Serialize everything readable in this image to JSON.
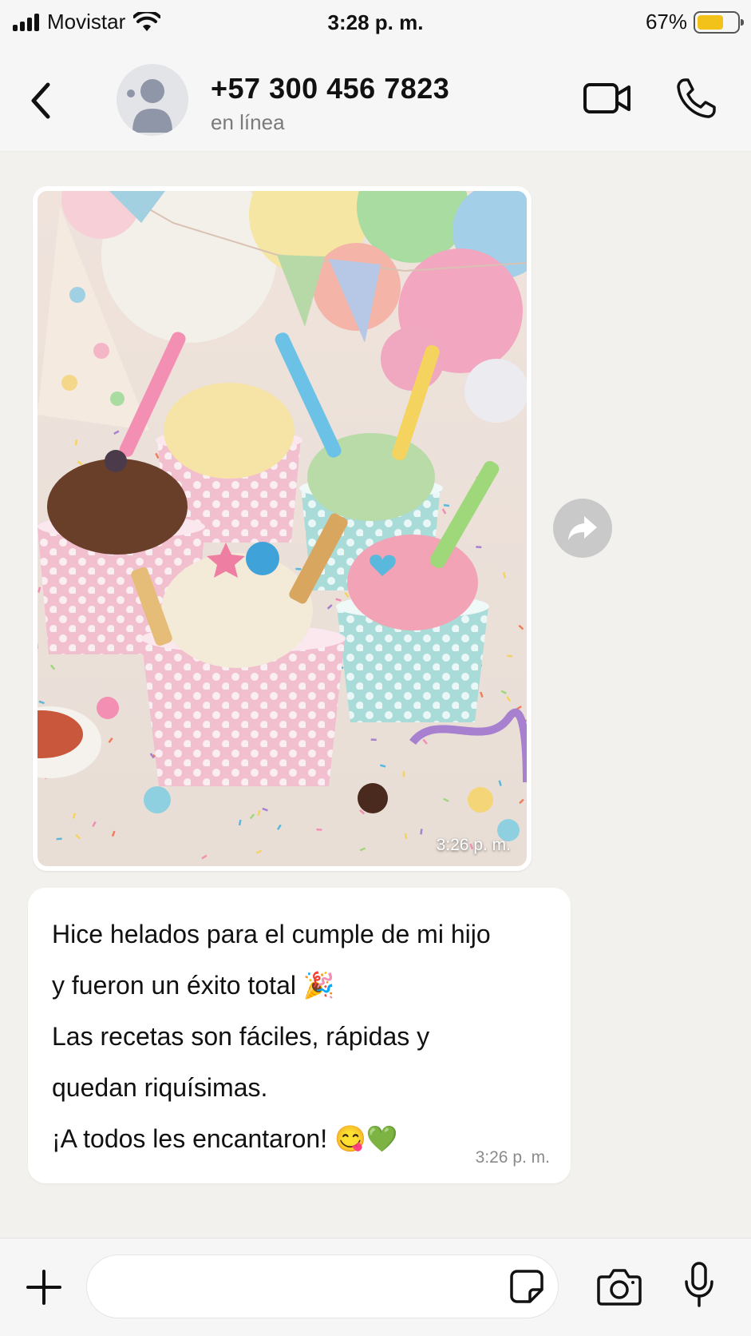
{
  "status_bar": {
    "carrier": "Movistar",
    "time": "3:28 p. m.",
    "battery": "67%",
    "battery_level": 0.67,
    "icons": [
      "signal-icon",
      "wifi-icon",
      "battery-icon"
    ]
  },
  "header": {
    "contact_name": "+57 300 456 7823",
    "contact_status": "en línea",
    "icons": [
      "back-chevron-icon",
      "avatar-placeholder-icon",
      "video-camera-icon",
      "phone-icon"
    ]
  },
  "messages": [
    {
      "type": "image",
      "description_icon": "ice-cream-party-photo",
      "time": "3:26 p. m."
    },
    {
      "type": "text",
      "lines": [
        "Hice helados para el cumple de mi hijo",
        "y fueron un éxito total 🎉",
        "Las recetas son fáciles, rápidas y",
        "quedan riquísimas.",
        "¡A todos les encantaron! 😋💚"
      ],
      "time": "3:26 p. m."
    }
  ],
  "input_bar": {
    "placeholder": "",
    "icons": [
      "plus-icon",
      "sticker-icon",
      "camera-icon",
      "microphone-icon"
    ]
  },
  "colors": {
    "chat_background": "#f3f1ed",
    "bar_background": "#f6f6f6",
    "battery_fill": "#f2c21b",
    "forward_button": "#c9c9c9"
  }
}
